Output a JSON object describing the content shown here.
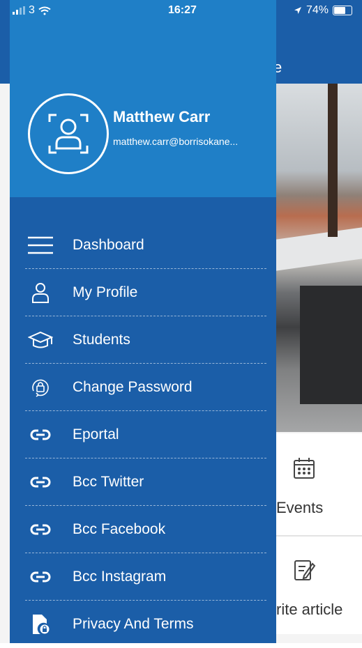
{
  "status_bar": {
    "signal_label": "3",
    "time": "16:27",
    "battery": "74%",
    "battery_level": 0.74
  },
  "background_app": {
    "header_title_fragment": "e",
    "cards": [
      {
        "icon": "calendar-icon",
        "label": "Events"
      },
      {
        "icon": "edit-icon",
        "label": "rite article"
      }
    ]
  },
  "drawer": {
    "user": {
      "name": "Matthew Carr",
      "email": "matthew.carr@borrisokane..."
    },
    "menu": [
      {
        "icon": "hamburger-icon",
        "label": "Dashboard"
      },
      {
        "icon": "person-icon",
        "label": "My Profile"
      },
      {
        "icon": "graduation-cap-icon",
        "label": "Students"
      },
      {
        "icon": "lock-refresh-icon",
        "label": "Change Password"
      },
      {
        "icon": "link-icon",
        "label": "Eportal"
      },
      {
        "icon": "link-icon",
        "label": "Bcc Twitter"
      },
      {
        "icon": "link-icon",
        "label": "Bcc Facebook"
      },
      {
        "icon": "link-icon",
        "label": "Bcc Instagram"
      },
      {
        "icon": "document-lock-icon",
        "label": "Privacy And Terms"
      }
    ]
  },
  "colors": {
    "drawer_bg": "#1b5ea8",
    "drawer_header_bg": "#1f7fc7",
    "text": "#ffffff"
  }
}
